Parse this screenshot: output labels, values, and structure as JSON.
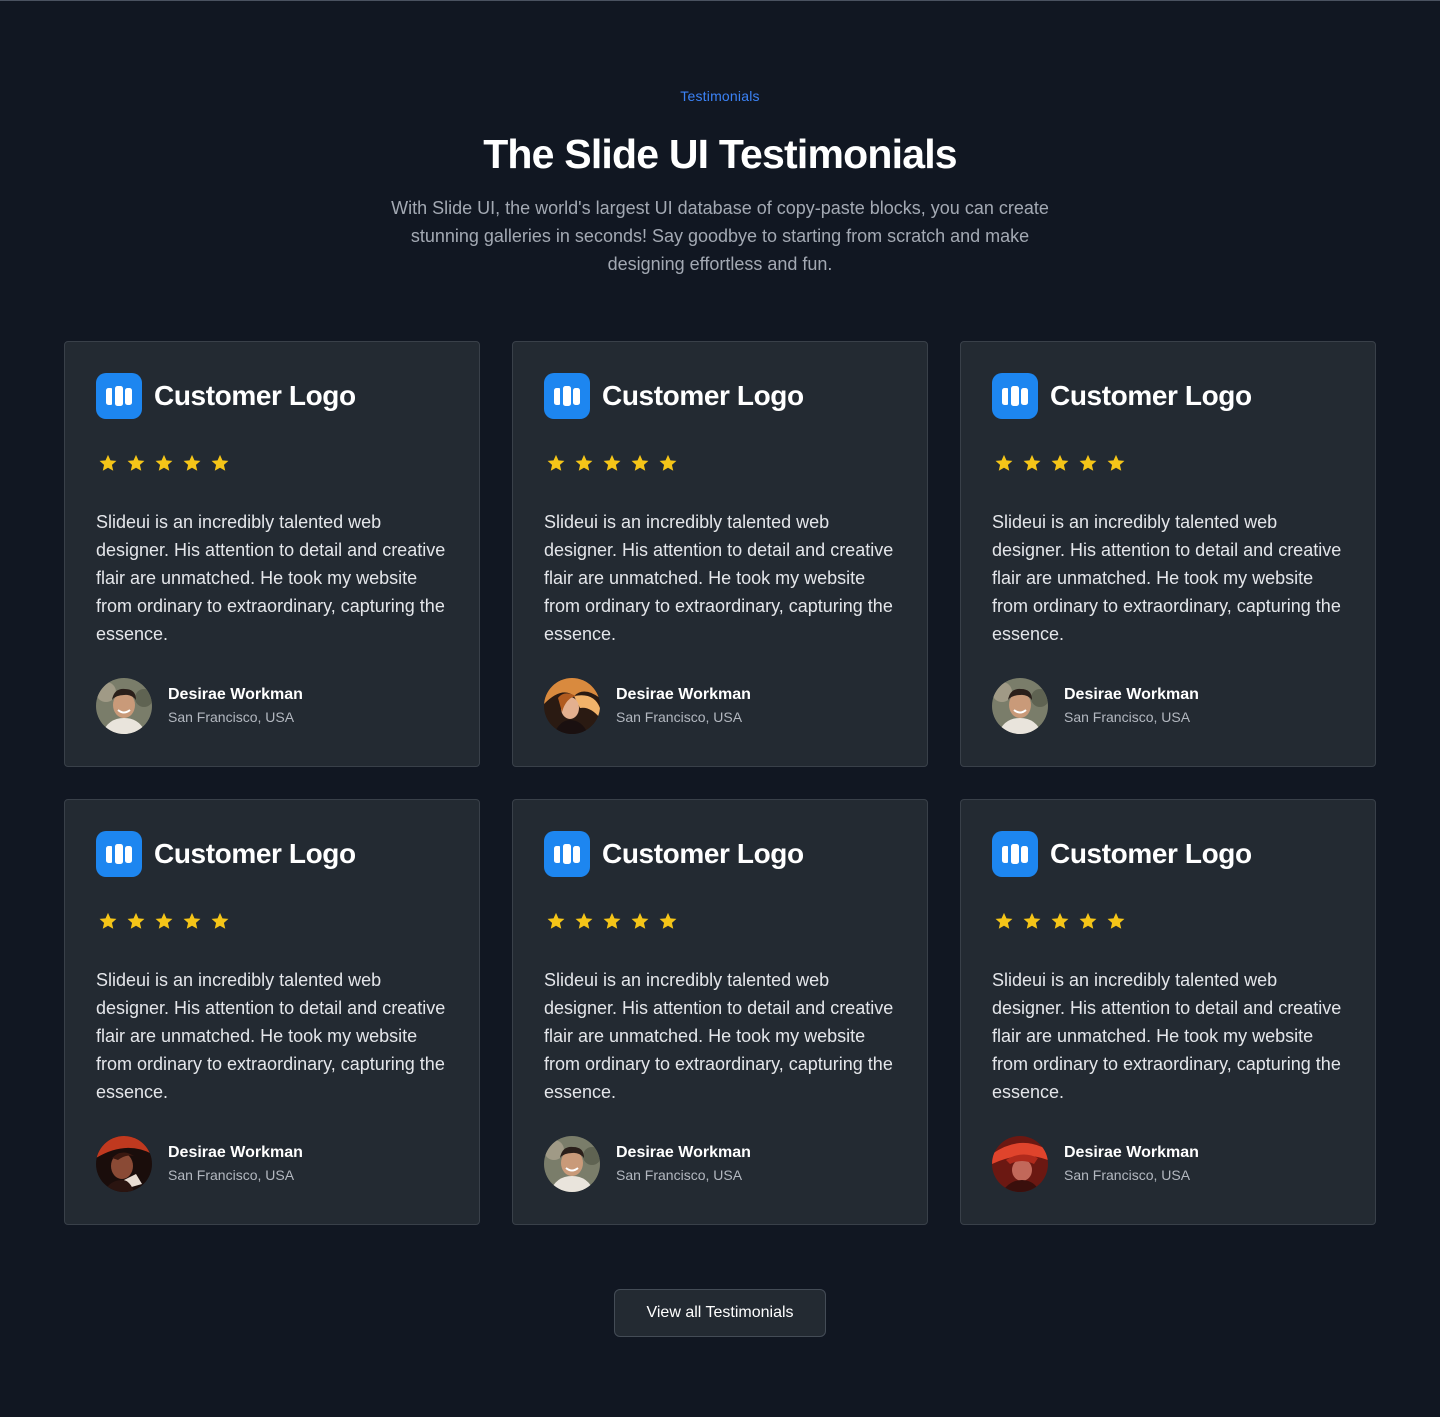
{
  "header": {
    "eyebrow": "Testimonials",
    "title": "The Slide UI Testimonials",
    "subtitle": "With Slide UI, the world's largest UI database of copy-paste blocks, you can create stunning galleries in seconds! Say goodbye to starting from scratch and make designing effortless and fun."
  },
  "colors": {
    "background": "#111722",
    "card": "#232a32",
    "accent": "#3b82f6",
    "logo": "#1d86f0",
    "star": "#f5c518"
  },
  "testimonials": [
    {
      "logo_icon": "customer-logo-icon",
      "logo_text": "Customer Logo",
      "rating": 5,
      "quote": "Slideui is an incredibly talented web designer. His attention to detail and creative flair are unmatched. He took my website from ordinary to extraordinary, capturing the essence.",
      "name": "Desirae Workman",
      "location": "San Francisco, USA",
      "avatar": "avatar-smiling-man"
    },
    {
      "logo_icon": "customer-logo-icon",
      "logo_text": "Customer Logo",
      "rating": 5,
      "quote": "Slideui is an incredibly talented web designer. His attention to detail and creative flair are unmatched. He took my website from ordinary to extraordinary, capturing the essence.",
      "name": "Desirae Workman",
      "location": "San Francisco, USA",
      "avatar": "avatar-woman-flowing-hair"
    },
    {
      "logo_icon": "customer-logo-icon",
      "logo_text": "Customer Logo",
      "rating": 5,
      "quote": "Slideui is an incredibly talented web designer. His attention to detail and creative flair are unmatched. He took my website from ordinary to extraordinary, capturing the essence.",
      "name": "Desirae Workman",
      "location": "San Francisco, USA",
      "avatar": "avatar-smiling-man"
    },
    {
      "logo_icon": "customer-logo-icon",
      "logo_text": "Customer Logo",
      "rating": 5,
      "quote": "Slideui is an incredibly talented web designer. His attention to detail and creative flair are unmatched. He took my website from ordinary to extraordinary, capturing the essence.",
      "name": "Desirae Workman",
      "location": "San Francisco, USA",
      "avatar": "avatar-man-red-light"
    },
    {
      "logo_icon": "customer-logo-icon",
      "logo_text": "Customer Logo",
      "rating": 5,
      "quote": "Slideui is an incredibly talented web designer. His attention to detail and creative flair are unmatched. He took my website from ordinary to extraordinary, capturing the essence.",
      "name": "Desirae Workman",
      "location": "San Francisco, USA",
      "avatar": "avatar-smiling-man"
    },
    {
      "logo_icon": "customer-logo-icon",
      "logo_text": "Customer Logo",
      "rating": 5,
      "quote": "Slideui is an incredibly talented web designer. His attention to detail and creative flair are unmatched. He took my website from ordinary to extraordinary, capturing the essence.",
      "name": "Desirae Workman",
      "location": "San Francisco, USA",
      "avatar": "avatar-red-hat"
    }
  ],
  "cta": {
    "label": "View all Testimonials"
  }
}
